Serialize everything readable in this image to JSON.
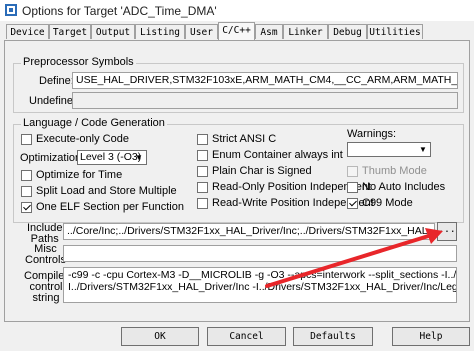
{
  "window": {
    "title": "Options for Target 'ADC_Time_DMA'",
    "icon": "keil-app-icon"
  },
  "tabs": [
    "Device",
    "Target",
    "Output",
    "Listing",
    "User",
    "C/C++",
    "Asm",
    "Linker",
    "Debug",
    "Utilities"
  ],
  "active_tab": "C/C++",
  "preprocessor": {
    "title": "Preprocessor Symbols",
    "define_label": "Define:",
    "define_value": "USE_HAL_DRIVER,STM32F103xE,ARM_MATH_CM4,__CC_ARM,ARM_MATH_MATRIX_CHECK,ARM",
    "undefine_label": "Undefine:",
    "undefine_value": ""
  },
  "language": {
    "title": "Language / Code Generation",
    "execute_only": {
      "label": "Execute-only Code",
      "checked": false
    },
    "optimization_label": "Optimization:",
    "optimization_value": "Level 3 (-O3)",
    "optimize_time": {
      "label": "Optimize for Time",
      "checked": false
    },
    "split_load": {
      "label": "Split Load and Store Multiple",
      "checked": false
    },
    "one_elf": {
      "label": "One ELF Section per Function",
      "checked": true
    },
    "strict_ansi": {
      "label": "Strict ANSI C",
      "checked": false
    },
    "enum_int": {
      "label": "Enum Container always int",
      "checked": false
    },
    "plain_char": {
      "label": "Plain Char is Signed",
      "checked": false
    },
    "ropi": {
      "label": "Read-Only Position Independent",
      "checked": false
    },
    "rwpi": {
      "label": "Read-Write Position Independent",
      "checked": false
    },
    "warnings_label": "Warnings:",
    "warnings_value": "",
    "thumb_mode": {
      "label": "Thumb Mode",
      "checked": false
    },
    "no_auto_includes": {
      "label": "No Auto Includes",
      "checked": false
    },
    "c99_mode": {
      "label": "C99 Mode",
      "checked": true
    }
  },
  "include": {
    "label_line1": "Include",
    "label_line2": "Paths",
    "value": "../Core/Inc;../Drivers/STM32F1xx_HAL_Driver/Inc;../Drivers/STM32F1xx_HAL_Driver/Inc/Legacy;",
    "browse_label": "..."
  },
  "misc": {
    "label_line1": "Misc",
    "label_line2": "Controls",
    "value": ""
  },
  "compiler": {
    "label_line1": "Compiler",
    "label_line2": "control",
    "label_line3": "string",
    "line1": "-c99 -c -cpu Cortex-M3 -D__MICROLIB -g -O3 --apcs=interwork --split_sections -I../Core/Inc -",
    "line2": "I../Drivers/STM32F1xx_HAL_Driver/Inc -I../Drivers/STM32F1xx_HAL_Driver/Inc/Legacy -"
  },
  "buttons": {
    "ok": "OK",
    "cancel": "Cancel",
    "defaults": "Defaults",
    "help": "Help"
  },
  "annotation": {
    "arrow_color": "#e8262a"
  }
}
